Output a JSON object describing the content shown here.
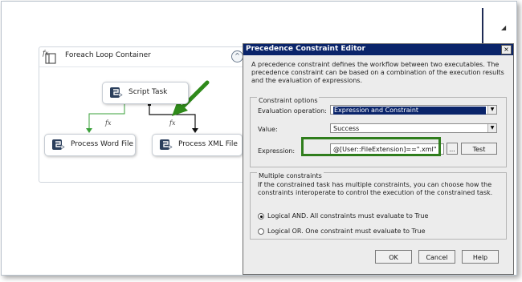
{
  "container": {
    "title": "Foreach Loop Container",
    "collapse_glyph": "^"
  },
  "tasks": {
    "script": "Script Task",
    "word": "Process Word File",
    "xml": "Process XML File"
  },
  "connector_fx": [
    "fx",
    "fx"
  ],
  "dialog": {
    "title": "Precedence Constraint Editor",
    "close_glyph": "×",
    "description": "A precedence constraint defines the workflow between two executables. The precedence constraint can be based on a combination of the execution results and the evaluation of expressions.",
    "constraint_options_title": "Constraint options",
    "evaluation_label": "Evaluation operation:",
    "evaluation_value": "Expression and Constraint",
    "value_label": "Value:",
    "value_value": "Success",
    "expression_label": "Expression:",
    "expression_value": "@[User::FileExtension]==\".xml\"",
    "ellipsis_label": "...",
    "test_label": "Test",
    "multiple_title": "Multiple constraints",
    "multiple_desc": "If the constrained task has multiple constraints, you can choose how the constraints interoperate to control the execution of the constrained task.",
    "logical_and": "Logical AND. All constraints must evaluate to True",
    "logical_or": "Logical OR. One constraint must evaluate to True",
    "selected_logic": "and",
    "ok_label": "OK",
    "cancel_label": "Cancel",
    "help_label": "Help"
  },
  "icons": [
    "container-icon",
    "script-task-icon",
    "task-icon",
    "close-icon",
    "dropdown-arrow-icon",
    "pointer-arrow-icon"
  ],
  "colors": {
    "titlebar": "#0a246a",
    "highlight": "#2f7d1c",
    "connector_green": "#3aa03a"
  }
}
